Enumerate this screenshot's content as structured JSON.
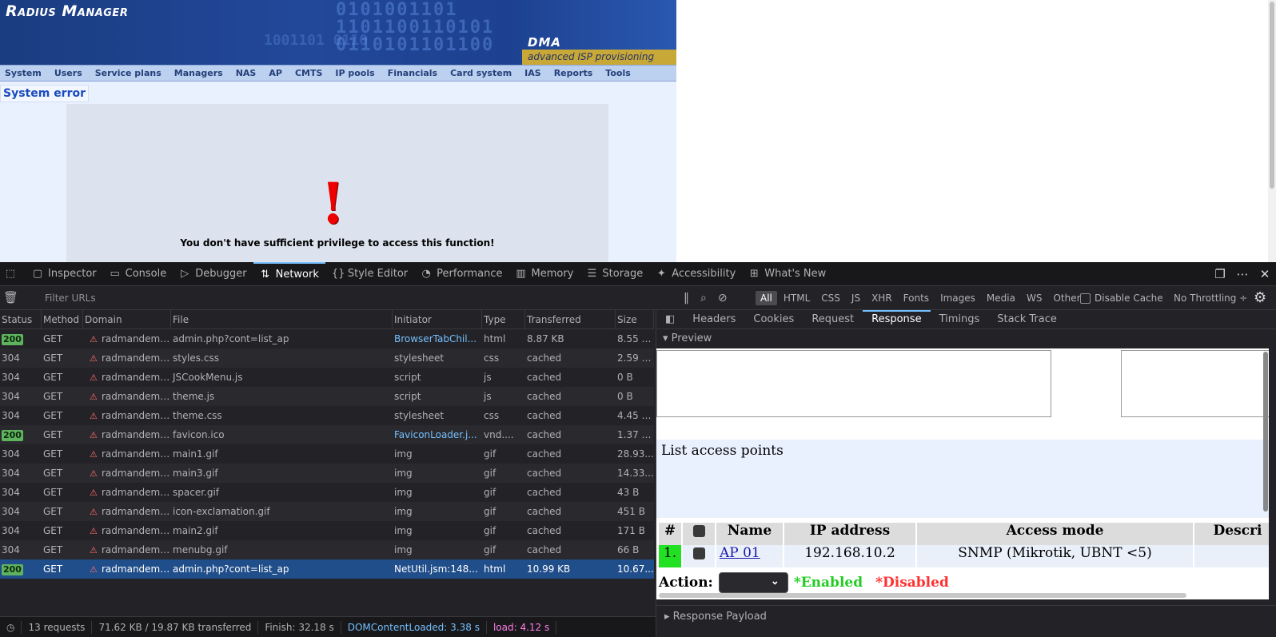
{
  "webpage": {
    "brand": "Radius Manager",
    "logo_text": "DMA",
    "tagline": "advanced ISP provisioning",
    "menu": [
      "System",
      "Users",
      "Service plans",
      "Managers",
      "NAS",
      "AP",
      "CMTS",
      "IP pools",
      "Financials",
      "Card system",
      "IAS",
      "Reports",
      "Tools"
    ],
    "section_title": "System error",
    "error_icon": "!",
    "error_message": "You don't have sufficient privilege to access this function!"
  },
  "devtools": {
    "tabs": [
      "Inspector",
      "Console",
      "Debugger",
      "Network",
      "Style Editor",
      "Performance",
      "Memory",
      "Storage",
      "Accessibility",
      "What's New"
    ],
    "active_tab": "Network",
    "filter_placeholder": "Filter URLs",
    "type_filters": [
      "All",
      "HTML",
      "CSS",
      "JS",
      "XHR",
      "Fonts",
      "Images",
      "Media",
      "WS",
      "Other"
    ],
    "disable_cache_label": "Disable Cache",
    "throttling": "No Throttling ÷",
    "columns": [
      "Status",
      "Method",
      "Domain",
      "File",
      "Initiator",
      "Type",
      "Transferred",
      "Size"
    ],
    "requests": [
      {
        "status": "200",
        "method": "GET",
        "domain": "radmandemo...",
        "file": "admin.php?cont=list_ap",
        "initiator": "BrowserTabChil...",
        "type": "html",
        "transferred": "8.87 KB",
        "size": "8.55 KB"
      },
      {
        "status": "304",
        "method": "GET",
        "domain": "radmandemo...",
        "file": "styles.css",
        "initiator": "stylesheet",
        "type": "css",
        "transferred": "cached",
        "size": "2.59 KB"
      },
      {
        "status": "304",
        "method": "GET",
        "domain": "radmandemo...",
        "file": "JSCookMenu.js",
        "initiator": "script",
        "type": "js",
        "transferred": "cached",
        "size": "0 B"
      },
      {
        "status": "304",
        "method": "GET",
        "domain": "radmandemo...",
        "file": "theme.js",
        "initiator": "script",
        "type": "js",
        "transferred": "cached",
        "size": "0 B"
      },
      {
        "status": "304",
        "method": "GET",
        "domain": "radmandemo...",
        "file": "theme.css",
        "initiator": "stylesheet",
        "type": "css",
        "transferred": "cached",
        "size": "4.45 KB"
      },
      {
        "status": "200",
        "method": "GET",
        "domain": "radmandemo...",
        "file": "favicon.ico",
        "initiator": "FaviconLoader.j...",
        "type": "vnd....",
        "transferred": "cached",
        "size": "1.37 KB"
      },
      {
        "status": "304",
        "method": "GET",
        "domain": "radmandemo...",
        "file": "main1.gif",
        "initiator": "img",
        "type": "gif",
        "transferred": "cached",
        "size": "28.93..."
      },
      {
        "status": "304",
        "method": "GET",
        "domain": "radmandemo...",
        "file": "main3.gif",
        "initiator": "img",
        "type": "gif",
        "transferred": "cached",
        "size": "14.33..."
      },
      {
        "status": "304",
        "method": "GET",
        "domain": "radmandemo...",
        "file": "spacer.gif",
        "initiator": "img",
        "type": "gif",
        "transferred": "cached",
        "size": "43 B"
      },
      {
        "status": "304",
        "method": "GET",
        "domain": "radmandemo...",
        "file": "icon-exclamation.gif",
        "initiator": "img",
        "type": "gif",
        "transferred": "cached",
        "size": "451 B"
      },
      {
        "status": "304",
        "method": "GET",
        "domain": "radmandemo...",
        "file": "main2.gif",
        "initiator": "img",
        "type": "gif",
        "transferred": "cached",
        "size": "171 B"
      },
      {
        "status": "304",
        "method": "GET",
        "domain": "radmandemo...",
        "file": "menubg.gif",
        "initiator": "img",
        "type": "gif",
        "transferred": "cached",
        "size": "66 B"
      },
      {
        "status": "200",
        "method": "GET",
        "domain": "radmandemo...",
        "file": "admin.php?cont=list_ap",
        "initiator": "NetUtil.jsm:148...",
        "type": "html",
        "transferred": "10.99 KB",
        "size": "10.67..."
      }
    ],
    "selected_index": 12,
    "statusbar": {
      "requests": "13 requests",
      "transferred": "71.62 KB / 19.87 KB transferred",
      "finish": "Finish: 32.18 s",
      "dcl": "DOMContentLoaded: 3.38 s",
      "load": "load: 4.12 s"
    },
    "detail_tabs": [
      "Headers",
      "Cookies",
      "Request",
      "Response",
      "Timings",
      "Stack Trace"
    ],
    "active_detail_tab": "Response",
    "preview_label": "Preview",
    "payload_label": "Response Payload"
  },
  "preview": {
    "title": "List access points",
    "headers": [
      "#",
      "",
      "Name",
      "IP address",
      "Access mode",
      "Descri"
    ],
    "row": {
      "num": "1.",
      "name": "AP 01",
      "ip": "192.168.10.2",
      "mode": "SNMP (Mikrotik, UBNT <5)"
    },
    "action_label": "Action:",
    "enabled_label": "*Enabled",
    "disabled_label": "*Disabled"
  },
  "colors": {
    "accent": "#75bfff",
    "selected_row": "#204e8a",
    "status_ok": "#5fb35f",
    "enabled": "#22cc22",
    "disabled": "#ff3030",
    "error": "#e00000"
  }
}
